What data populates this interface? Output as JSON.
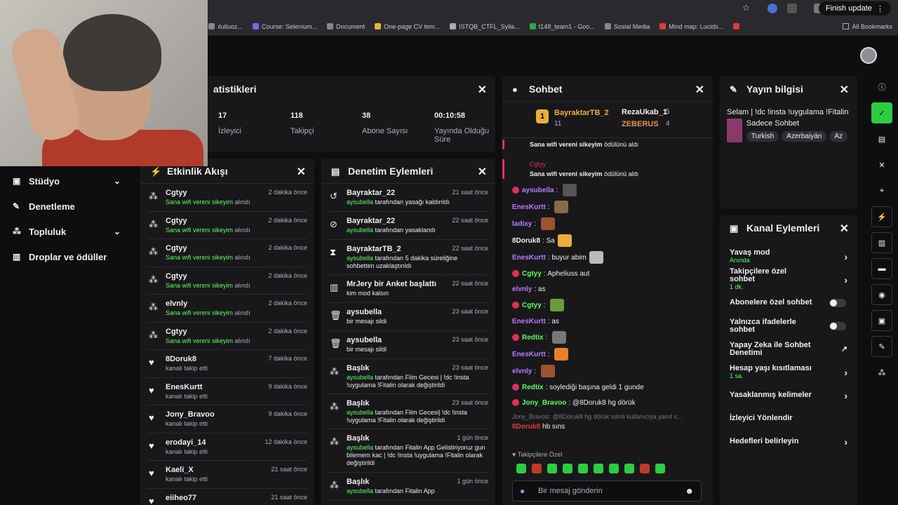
{
  "browser": {
    "finish_update": "Finish update",
    "bookmarks": [
      {
        "label": "ılutluoz...",
        "color": "#888"
      },
      {
        "label": "Course: Selenium...",
        "color": "#8a5cf6"
      },
      {
        "label": "Document",
        "color": "#888"
      },
      {
        "label": "One-page CV tem...",
        "color": "#e8b03a"
      },
      {
        "label": "ISTQB_CTFL_Sylla...",
        "color": "#aaa"
      },
      {
        "label": "t148_team1 - Goo...",
        "color": "#2fa84f"
      },
      {
        "label": "Sosial Media",
        "color": "#888"
      },
      {
        "label": "Mind map: Lucids...",
        "color": "#e03a3a"
      },
      {
        "label": "",
        "color": "#e03a3a"
      }
    ],
    "all_bookmarks": "All Bookmarks"
  },
  "sidebar": {
    "items": [
      {
        "label": "Stüdyo",
        "icon": "studio-icon",
        "has_chevron": true
      },
      {
        "label": "Denetleme",
        "icon": "wrench-icon",
        "has_chevron": false
      },
      {
        "label": "Topluluk",
        "icon": "community-icon",
        "has_chevron": true
      },
      {
        "label": "Droplar ve ödüller",
        "icon": "drops-icon",
        "has_chevron": false
      }
    ]
  },
  "stats": {
    "title": "atistikleri",
    "items": [
      {
        "value": "17",
        "label": "İzleyici"
      },
      {
        "value": "118",
        "label": "Takipçi"
      },
      {
        "value": "38",
        "label": "Abone Sayısı"
      },
      {
        "value": "00:10:58",
        "label": "Yayında Olduğu Süre"
      }
    ]
  },
  "activity": {
    "title": "Etkinlik Akışı",
    "items": [
      {
        "name": "Cgtyy",
        "desc_g": "Sana wifi vereni sikeyim",
        "desc": " alındı",
        "time": "2 dakika önce",
        "icon": "points-icon"
      },
      {
        "name": "Cgtyy",
        "desc_g": "Sana wifi vereni sikeyim",
        "desc": " alındı",
        "time": "2 dakika önce",
        "icon": "points-icon"
      },
      {
        "name": "Cgtyy",
        "desc_g": "Sana wifi vereni sikeyim",
        "desc": " alındı",
        "time": "2 dakika önce",
        "icon": "points-icon"
      },
      {
        "name": "Cgtyy",
        "desc_g": "Sana wifi vereni sikeyim",
        "desc": " alındı",
        "time": "2 dakika önce",
        "icon": "points-icon"
      },
      {
        "name": "elvnly",
        "desc_g": "Sana wifi vereni sikeyim",
        "desc": " alındı",
        "time": "2 dakika önce",
        "icon": "points-icon"
      },
      {
        "name": "Cgtyy",
        "desc_g": "Sana wifi vereni sikeyim",
        "desc": " alındı",
        "time": "2 dakika önce",
        "icon": "points-icon"
      },
      {
        "name": "8Doruk8",
        "desc_g": "",
        "desc": "kanalı takip etti",
        "time": "7 dakika önce",
        "icon": "heart-icon"
      },
      {
        "name": "EnesKurtt",
        "desc_g": "",
        "desc": "kanalı takip etti",
        "time": "9 dakika önce",
        "icon": "heart-icon"
      },
      {
        "name": "Jony_Bravoo",
        "desc_g": "",
        "desc": "kanalı takip etti",
        "time": "9 dakika önce",
        "icon": "heart-icon"
      },
      {
        "name": "erodayi_14",
        "desc_g": "",
        "desc": "kanalı takip etti",
        "time": "12 dakika önce",
        "icon": "heart-icon"
      },
      {
        "name": "Kaeli_X",
        "desc_g": "",
        "desc": "kanalı takip etti",
        "time": "21 saat önce",
        "icon": "heart-icon"
      },
      {
        "name": "eiiheo77",
        "desc_g": "",
        "desc": "",
        "time": "21 saat önce",
        "icon": "heart-icon"
      }
    ]
  },
  "moderation": {
    "title": "Denetim Eylemleri",
    "items": [
      {
        "name": "Bayraktar_22",
        "desc_g": "aysubella",
        "desc": " tarafından yasağı kaldırıldı",
        "time": "21 saat önce",
        "h": 40
      },
      {
        "name": "Bayraktar_22",
        "desc_g": "aysubella",
        "desc": " tarafından yasaklandı",
        "time": "22 saat önce",
        "h": 40
      },
      {
        "name": "BayraktarTB_2",
        "desc_g": "aysubella",
        "desc": " tarafından 5 dakika süreliğine sohbetten uzaklaştırıldı",
        "time": "22 saat önce",
        "h": 50
      },
      {
        "name": "MrJery bir Anket başlattı",
        "desc_g": "",
        "desc": "kim mod kalsın",
        "time": "22 saat önce",
        "h": 40
      },
      {
        "name": "aysubella",
        "desc_g": "",
        "desc": "bir mesajı sildi",
        "time": "23 saat önce",
        "h": 40
      },
      {
        "name": "aysubella",
        "desc_g": "",
        "desc": "bir mesajı sildi",
        "time": "23 saat önce",
        "h": 40
      },
      {
        "name": "Başlık",
        "desc_g": "aysubella",
        "desc": " tarafından Film Gecesi | !dc !insta !uygulama !Fitalin olarak değiştirildi",
        "time": "23 saat önce",
        "h": 50
      },
      {
        "name": "Başlık",
        "desc_g": "aysubella",
        "desc": " tarafından Film Gecesi| !dc !insta !uygulama !Fitalin olarak değiştirildi",
        "time": "23 saat önce",
        "h": 50
      },
      {
        "name": "Başlık",
        "desc_g": "aysubella",
        "desc": " tarafından Fitalin App Gelistiriyoruz gun bilemem kac | !dc !insta !uygulama !Fitalin olarak değiştirildi",
        "time": "1 gün önce",
        "h": 62
      },
      {
        "name": "Başlık",
        "desc_g": "aysubella",
        "desc": " tarafından Fitalin App",
        "time": "1 gün önce",
        "h": 40
      }
    ]
  },
  "chat": {
    "title": "Sohbet",
    "leaders": {
      "first": {
        "name": "BayraktarTB_2",
        "count": "11"
      },
      "second": {
        "name": "RezaUkab_1",
        "count": "5"
      },
      "third": {
        "name": "ZEBERUS",
        "count": "4"
      }
    },
    "redeem": [
      {
        "user": "",
        "text": "Sana wifi vereni sikeyim",
        "suffix": " ödülünü aldı"
      },
      {
        "user": "Cgtyy",
        "text": "Sana wifi vereni sikeyim",
        "suffix": " ödülünü aldı"
      }
    ],
    "messages": [
      {
        "user": "aysubella",
        "color": "#b57cff",
        "text": "",
        "emote": true
      },
      {
        "user": "EnesKurtt",
        "color": "#b57cff",
        "text": "",
        "emote": true
      },
      {
        "user": "ladixy",
        "color": "#b57cff",
        "text": "",
        "emote": true
      },
      {
        "user": "8Doruk8",
        "color": "#efeff1",
        "text": "Sa",
        "emote": true
      },
      {
        "user": "EnesKurtt",
        "color": "#b57cff",
        "text": "buyur abim",
        "emote": true
      },
      {
        "user": "Cgtyy",
        "color": "#5dff5d",
        "text": "Apheliuss aut",
        "emote": false
      },
      {
        "user": "elvnly",
        "color": "#b57cff",
        "text": "as",
        "emote": false
      },
      {
        "user": "Cgtyy",
        "color": "#5dff5d",
        "text": "",
        "emote": true
      },
      {
        "user": "EnesKurtt",
        "color": "#b57cff",
        "text": "as",
        "emote": false
      },
      {
        "user": "Redtix",
        "color": "#5dff5d",
        "text": "",
        "emote": true
      },
      {
        "user": "EnesKurtt",
        "color": "#b57cff",
        "text": "",
        "emote": true
      },
      {
        "user": "elvnly",
        "color": "#b57cff",
        "text": "",
        "emote": true
      },
      {
        "user": "Redtix",
        "color": "#5dff5d",
        "text": "soylediği başına geldi 1 gunde",
        "emote": false
      },
      {
        "user": "Jony_Bravoo",
        "color": "#5dff5d",
        "text": "@8Doruk8 hg dörük",
        "emote": false
      }
    ],
    "reply_hint": "Jony_Bravoo: @8Doruk8 hg dörük isimli kullanıcıya yanıt v...",
    "last": {
      "user": "8Doruk8",
      "text": "hb sıns"
    },
    "followers_only": "Takipçilere Özel",
    "placeholder": "Bir mesaj gönderin"
  },
  "stream_info": {
    "title": "Yayın bilgisi",
    "stream_title": "Selam | !dc !insta !uygulama !Fitalin",
    "category": "Sadece Sohbet",
    "tags": [
      "Turkish",
      "Azerbaiyán",
      "Az"
    ]
  },
  "channel_actions": {
    "title": "Kanal Eylemleri",
    "items": [
      {
        "label": "Yavaş mod",
        "sub": "Anında",
        "ctrl": "arrow"
      },
      {
        "label": "Takipçilere özel sohbet",
        "sub": "1 dk.",
        "ctrl": "arrow"
      },
      {
        "label": "Abonelere özel sohbet",
        "sub": "",
        "ctrl": "toggle"
      },
      {
        "label": "Yalnızca ifadelerle sohbet",
        "sub": "",
        "ctrl": "toggle"
      },
      {
        "label": "Yapay Zeka ile Sohbet Denetimi",
        "sub": "",
        "ctrl": "external"
      },
      {
        "label": "Hesap yaşı kısıtlaması",
        "sub": "1 sa.",
        "ctrl": "arrow"
      },
      {
        "label": "Yasaklanmış kelimeler",
        "sub": "",
        "ctrl": "arrow"
      },
      {
        "label": "İzleyici Yönlendir",
        "sub": "",
        "ctrl": "none"
      },
      {
        "label": "Hedefleri belirleyin",
        "sub": "",
        "ctrl": "arrow"
      }
    ]
  }
}
